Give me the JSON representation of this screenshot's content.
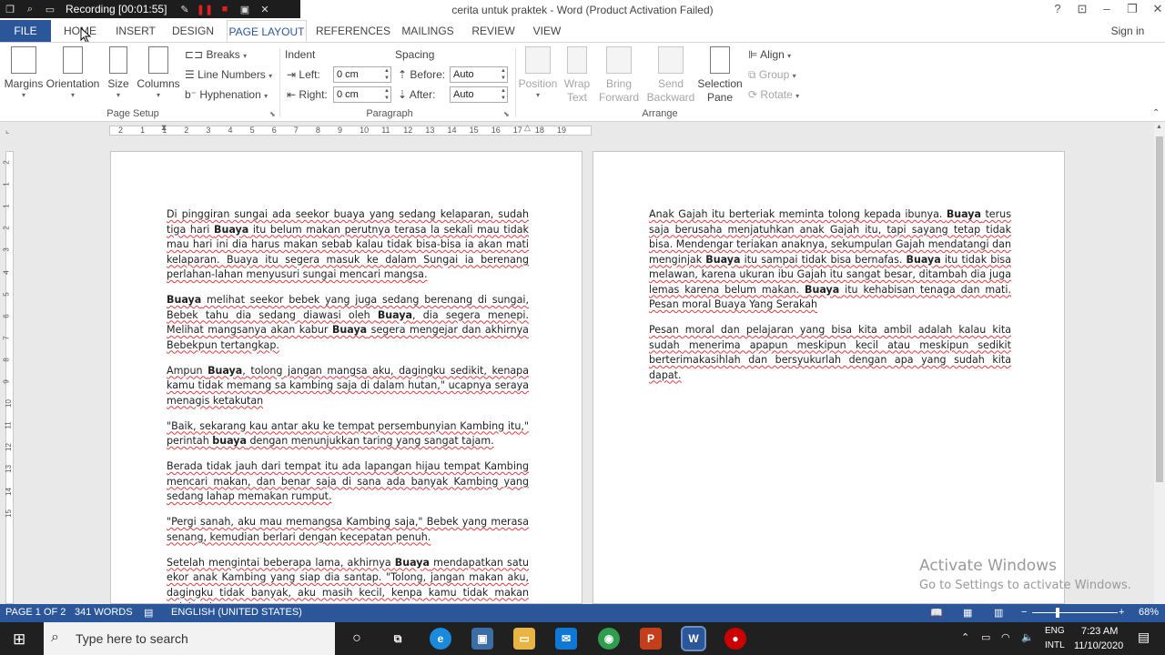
{
  "recording": {
    "label": "Recording [00:01:55]"
  },
  "window": {
    "title": "cerita untuk praktek - Word (Product Activation Failed)"
  },
  "tabs": [
    {
      "label": "FILE"
    },
    {
      "label": "HOME"
    },
    {
      "label": "INSERT"
    },
    {
      "label": "DESIGN"
    },
    {
      "label": "PAGE LAYOUT"
    },
    {
      "label": "REFERENCES"
    },
    {
      "label": "MAILINGS"
    },
    {
      "label": "REVIEW"
    },
    {
      "label": "VIEW"
    }
  ],
  "signin": "Sign in",
  "ribbon": {
    "page_setup": {
      "margins": "Margins",
      "orientation": "Orientation",
      "size": "Size",
      "columns": "Columns",
      "breaks": "Breaks",
      "line_numbers": "Line Numbers",
      "hyphenation": "Hyphenation",
      "group_label": "Page Setup"
    },
    "paragraph": {
      "indent_label": "Indent",
      "spacing_label": "Spacing",
      "left_label": "Left:",
      "right_label": "Right:",
      "before_label": "Before:",
      "after_label": "After:",
      "left_value": "0 cm",
      "right_value": "0 cm",
      "before_value": "Auto",
      "after_value": "Auto",
      "group_label": "Paragraph"
    },
    "arrange": {
      "position": "Position",
      "wrap_1": "Wrap",
      "wrap_2": "Text",
      "bring_1": "Bring",
      "bring_2": "Forward",
      "send_1": "Send",
      "send_2": "Backward",
      "selection_1": "Selection",
      "selection_2": "Pane",
      "align": "Align",
      "group": "Group",
      "rotate": "Rotate",
      "group_label": "Arrange"
    }
  },
  "ruler": {
    "ticks": [
      "2",
      "1",
      "1",
      "2",
      "3",
      "4",
      "5",
      "6",
      "7",
      "8",
      "9",
      "10",
      "11",
      "12",
      "13",
      "14",
      "15",
      "16",
      "17",
      "18",
      "19"
    ],
    "vticks": [
      "2",
      "1",
      "1",
      "2",
      "3",
      "4",
      "5",
      "6",
      "7",
      "8",
      "9",
      "10",
      "11",
      "12",
      "13",
      "14",
      "15"
    ]
  },
  "page1": {
    "paragraphs": [
      [
        "Di pinggiran sungai ada seekor buaya yang sedang kelaparan, sudah tiga hari ",
        "Buaya",
        " itu belum makan perutnya terasa la sekali mau tidak mau hari ini dia harus makan sebab kalau tidak bisa-bisa ia akan mati kelaparan. Buaya itu segera masuk ke dalam Sungai ia berenang perlahan-lahan menyusuri sungai mencari mangsa."
      ],
      [
        "",
        "Buaya",
        " melihat seekor bebek yang juga sedang berenang di sungai, Bebek tahu dia sedang diawasi oleh ",
        "Buaya",
        ", dia segera menepi. Melihat mangsanya akan kabur ",
        "Buaya",
        " segera mengejar dan akhirnya Bebekpun tertangkap."
      ],
      [
        "Ampun ",
        "Buaya",
        ", tolong jangan mangsa aku, dagingku sedikit, kenapa kamu tidak memang sa kambing saja di dalam hutan,\" ucapnya seraya menagis ketakutan"
      ],
      [
        "\"Baik, sekarang kau antar aku ke tempat persembunyian Kambing itu,\" perintah ",
        "buaya",
        " dengan menunjukkan taring yang sangat tajam."
      ],
      [
        "Berada tidak jauh dari tempat itu ada lapangan hijau tempat Kambing mencari makan, dan benar saja di sana ada banyak Kambing yang sedang lahap memakan rumput."
      ],
      [
        "\"Pergi sanah, aku mau memangsa Kambing saja,\" Bebek yang merasa senang, kemudian berlari dengan kecepatan penuh."
      ],
      [
        "Setelah mengintai beberapa lama, akhirnya ",
        "Buaya",
        " mendapatkan satu ekor anak Kambing yang siap dia santap. \"Tolong, jangan makan aku, dagingku tidak banyak, aku masih kecil, kenpa kamu tidak makan gajah saja yang"
      ]
    ]
  },
  "page2": {
    "paragraphs": [
      [
        "Anak Gajah itu berteriak meminta tolong kepada ibunya. ",
        "Buaya",
        " terus saja berusaha menjatuhkan anak Gajah itu, tapi sayang tetap tidak bisa. Mendengar teriakan anaknya, sekumpulan Gajah mendatangi dan menginjak ",
        "Buaya",
        " itu sampai tidak bisa bernafas. ",
        "Buaya",
        " itu tidak bisa melawan, karena ukuran ibu Gajah itu sangat besar, ditambah dia juga lemas karena belum makan. ",
        "Buaya",
        " itu kehabisan tenaga dan mati. Pesan moral Buaya Yang Serakah"
      ],
      [
        "Pesan moral dan pelajaran yang bisa kita ambil adalah kalau kita sudah menerima apapun meskipun kecil atau meskipun sedikit berterimakasihlah dan bersyukurlah dengan apa yang sudah kita dapat."
      ]
    ]
  },
  "watermark": {
    "line1": "Activate Windows",
    "line2": "Go to Settings to activate Windows."
  },
  "status": {
    "page": "PAGE 1 OF 2",
    "words": "341 WORDS",
    "language": "ENGLISH (UNITED STATES)",
    "zoom": "68%"
  },
  "taskbar": {
    "search_placeholder": "Type here to search",
    "lang1": "ENG",
    "lang2": "INTL",
    "time": "7:23 AM",
    "date": "11/10/2020"
  }
}
